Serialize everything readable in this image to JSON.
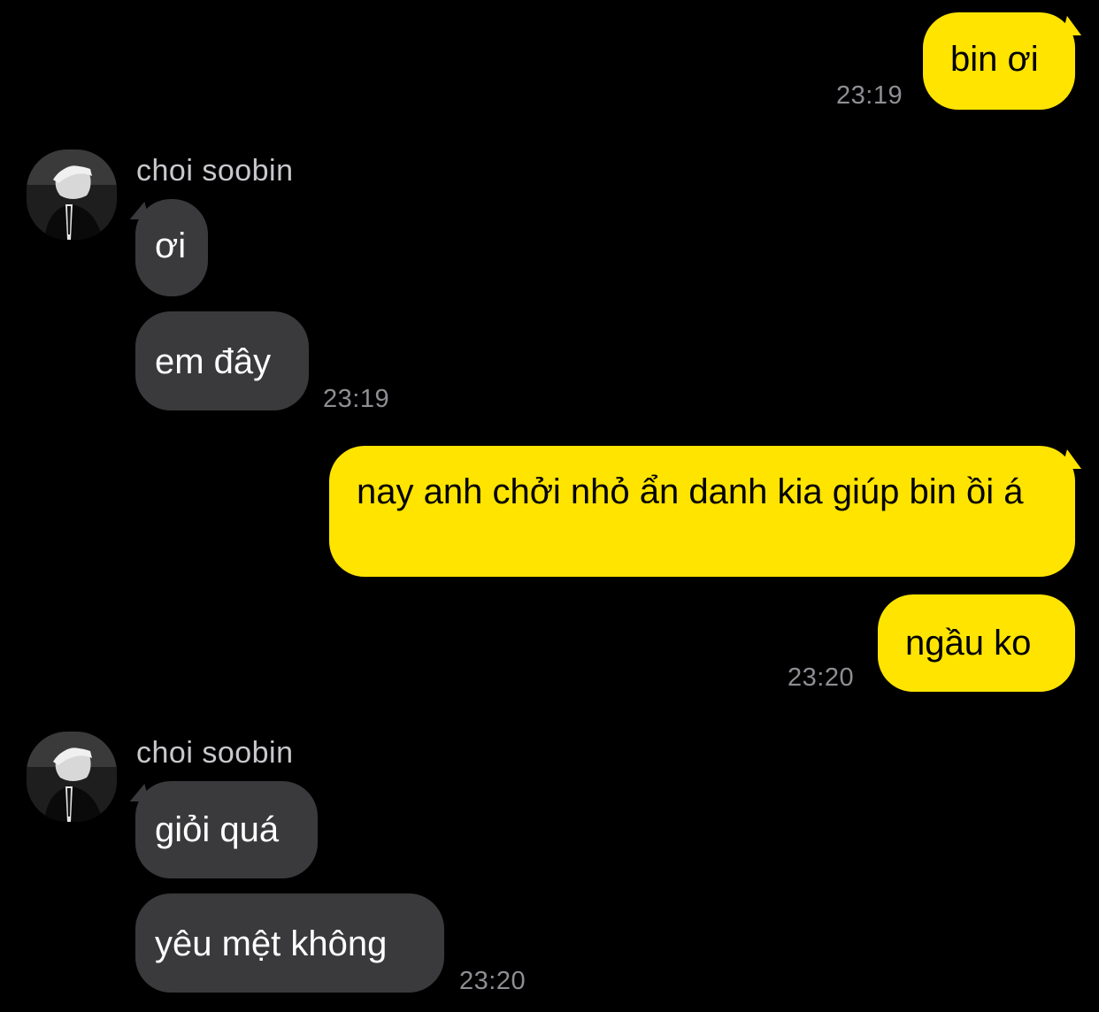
{
  "chat": {
    "contact_name": "choi soobin",
    "colors": {
      "background": "#000000",
      "sent_bubble": "#ffe400",
      "received_bubble": "#3a3a3c",
      "timestamp": "#8e8e93"
    },
    "avatar_icon": "profile-photo-avatar",
    "messages": [
      {
        "side": "sent",
        "text": "bin ơi",
        "time": "23:19"
      },
      {
        "side": "received",
        "sender": "choi soobin",
        "text": "ơi"
      },
      {
        "side": "received",
        "text": "em đây",
        "time": "23:19"
      },
      {
        "side": "sent",
        "text": "nay anh chởi nhỏ ẩn danh kia giúp bin ồi á"
      },
      {
        "side": "sent",
        "text": "ngầu ko",
        "time": "23:20"
      },
      {
        "side": "received",
        "sender": "choi soobin",
        "text": "giỏi quá"
      },
      {
        "side": "received",
        "text": "yêu mệt không",
        "time": "23:20"
      }
    ]
  }
}
